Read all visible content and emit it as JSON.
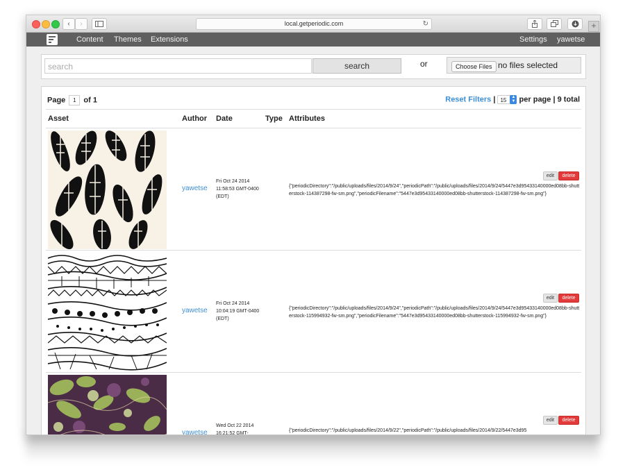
{
  "browser": {
    "url": "local.getperiodic.com"
  },
  "nav": {
    "left": [
      "Content",
      "Themes",
      "Extensions"
    ],
    "right": [
      "Settings",
      "yawetse"
    ]
  },
  "search": {
    "placeholder": "search",
    "button": "search",
    "or": "or",
    "choose_files": "Choose Files",
    "no_files": "no files selected"
  },
  "pagination": {
    "page_label": "Page",
    "page_value": "1",
    "of_label": "of 1",
    "reset_filters": "Reset Filters",
    "separator": "|",
    "per_page_value": "15",
    "per_page_label": "per page",
    "total": "| 9 total"
  },
  "table": {
    "headers": {
      "asset": "Asset",
      "author": "Author",
      "date": "Date",
      "type": "Type",
      "attributes": "Attributes"
    },
    "rows": [
      {
        "author": "yawetse",
        "date": "Fri Oct 24 2014 11:58:53 GMT-0400 (EDT)",
        "attributes": "{\"periodicDirectory\":\"/public/uploads/files/2014/9/24\",\"periodicPath\":\"/public/uploads/files/2014/9/24/5447e3d95433140000ed08bb-shutterstock-114387298-fw-sm.png\",\"periodicFilename\":\"5447e3d95433140000ed08bb-shutterstock-114387298-fw-sm.png\"}",
        "edit": "edit",
        "delete": "delete"
      },
      {
        "author": "yawetse",
        "date": "Fri Oct 24 2014 10:04:19 GMT-0400 (EDT)",
        "attributes": "{\"periodicDirectory\":\"/public/uploads/files/2014/9/24\",\"periodicPath\":\"/public/uploads/files/2014/9/24/5447e3d95433140000ed08bb-shutterstock-115994932-fw-sm.png\",\"periodicFilename\":\"5447e3d95433140000ed08bb-shutterstock-115994932-fw-sm.png\"}",
        "edit": "edit",
        "delete": "delete"
      },
      {
        "author": "yawetse",
        "date": "Wed Oct 22 2014 16:21:52 GMT-",
        "attributes": "{\"periodicDirectory\":\"/public/uploads/files/2014/9/22\",\"periodicPath\":\"/public/uploads/files/2014/9/22/5447e3d95",
        "edit": "edit",
        "delete": "delete"
      }
    ]
  },
  "colors": {
    "link": "#3f8fd6",
    "navbar": "#5f5f5f",
    "delete": "#e23a3a",
    "thumb3_bg": "#4b2c46",
    "thumb3_accent": "#a8c95e"
  }
}
